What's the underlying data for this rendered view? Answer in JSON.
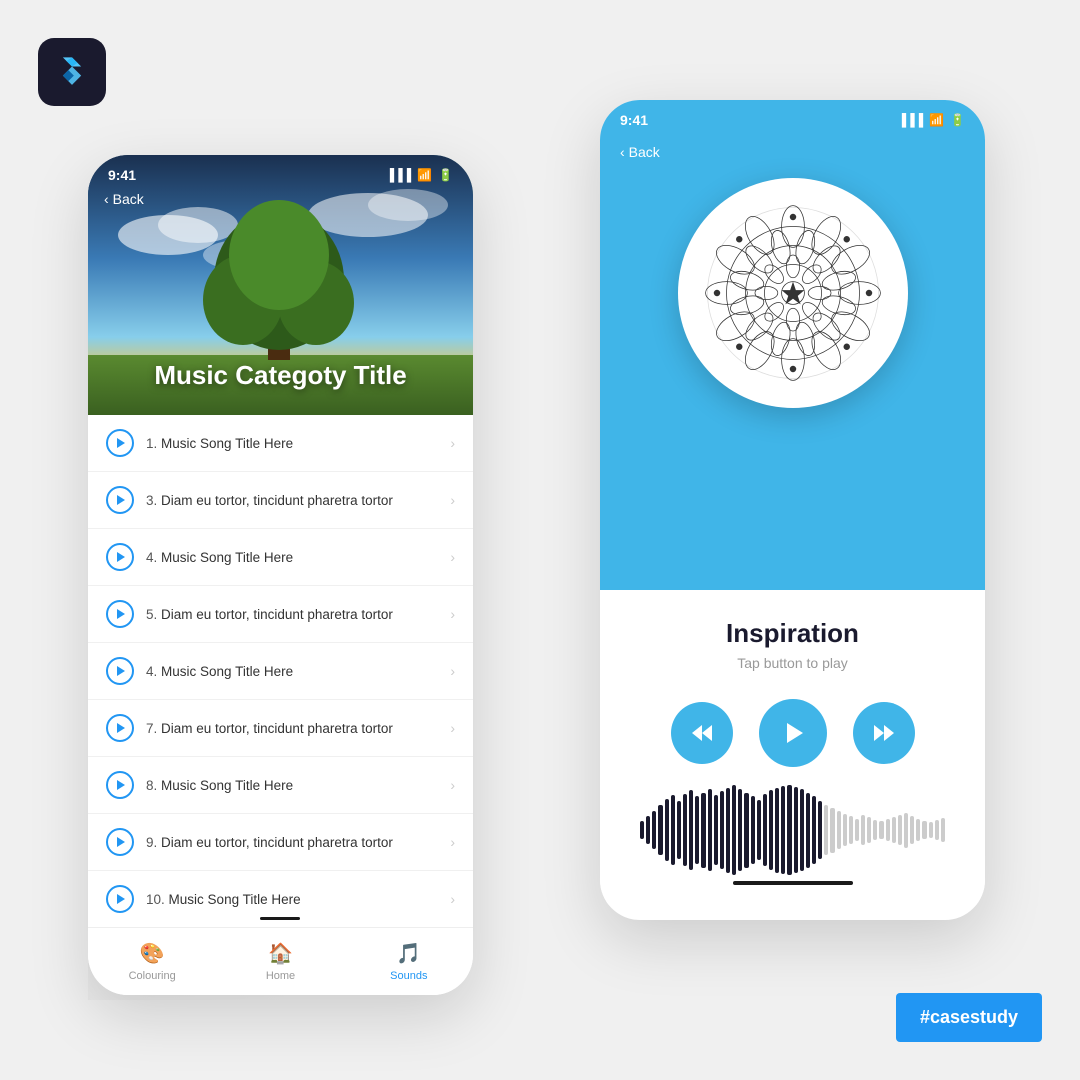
{
  "flutter_icon": "flutter",
  "casestudy": "#casestudy",
  "left_phone": {
    "status_time": "9:41",
    "back_label": "Back",
    "category_title": "Music Categoty Title",
    "songs": [
      {
        "num": "1.",
        "title": "Music Song Title Here"
      },
      {
        "num": "3.",
        "title": "Diam eu tortor, tincidunt pharetra tortor"
      },
      {
        "num": "4.",
        "title": "Music Song Title Here"
      },
      {
        "num": "5.",
        "title": "Diam eu tortor, tincidunt pharetra tortor"
      },
      {
        "num": "4.",
        "title": "Music Song Title Here"
      },
      {
        "num": "7.",
        "title": "Diam eu tortor, tincidunt pharetra tortor"
      },
      {
        "num": "8.",
        "title": "Music Song Title Here"
      },
      {
        "num": "9.",
        "title": "Diam eu tortor, tincidunt pharetra tortor"
      },
      {
        "num": "10.",
        "title": "Music Song Title Here"
      }
    ],
    "nav": [
      {
        "icon": "🎨",
        "label": "Colouring",
        "active": false
      },
      {
        "icon": "🏠",
        "label": "Home",
        "active": false
      },
      {
        "icon": "🎵",
        "label": "Sounds",
        "active": true
      }
    ]
  },
  "right_phone": {
    "status_time": "9:41",
    "back_label": "Back",
    "song_title": "Inspiration",
    "song_subtitle": "Tap button to play",
    "controls": {
      "rewind": "⏮",
      "play": "▶",
      "forward": "⏭"
    }
  }
}
